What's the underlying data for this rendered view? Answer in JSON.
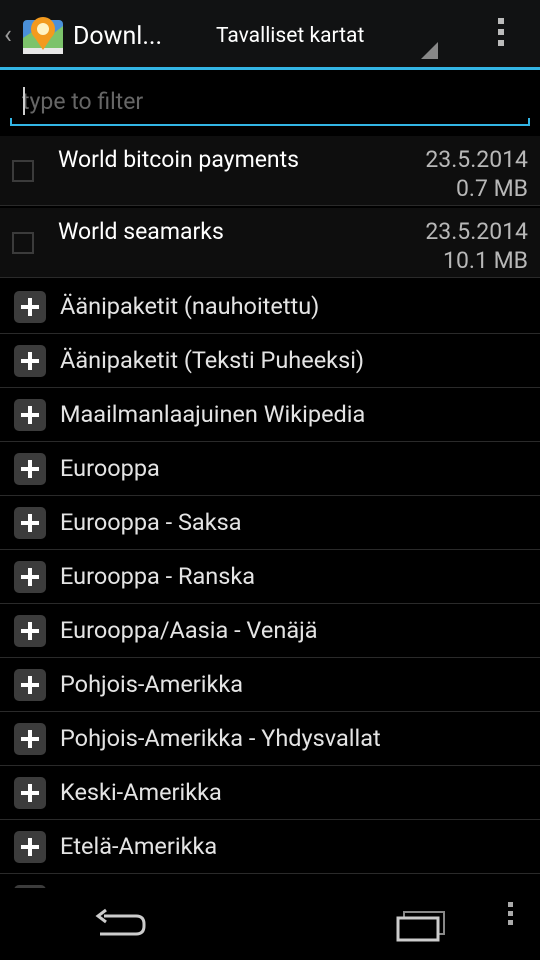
{
  "header": {
    "title": "Downl...",
    "spinner_label": "Tavalliset kartat",
    "accent_color": "#33b5e5"
  },
  "filter": {
    "placeholder": "type to filter",
    "value": ""
  },
  "maps": [
    {
      "name": "World bitcoin payments",
      "date": "23.5.2014",
      "size": "0.7 MB",
      "checked": false
    },
    {
      "name": "World seamarks",
      "date": "23.5.2014",
      "size": "10.1 MB",
      "checked": false
    }
  ],
  "groups": [
    "Äänipaketit (nauhoitettu)",
    "Äänipaketit (Teksti Puheeksi)",
    "Maailmanlaajuinen Wikipedia",
    "Eurooppa",
    "Eurooppa - Saksa",
    "Eurooppa - Ranska",
    "Eurooppa/Aasia - Venäjä",
    "Pohjois-Amerikka",
    "Pohjois-Amerikka - Yhdysvallat",
    "Keski-Amerikka",
    "Etelä-Amerikka"
  ],
  "icons": {
    "app": "osmand-map-icon",
    "overflow": "overflow-menu-icon",
    "expand": "plus-icon",
    "nav_back": "back-icon",
    "nav_recents": "recent-apps-icon",
    "nav_menu": "menu-icon"
  }
}
